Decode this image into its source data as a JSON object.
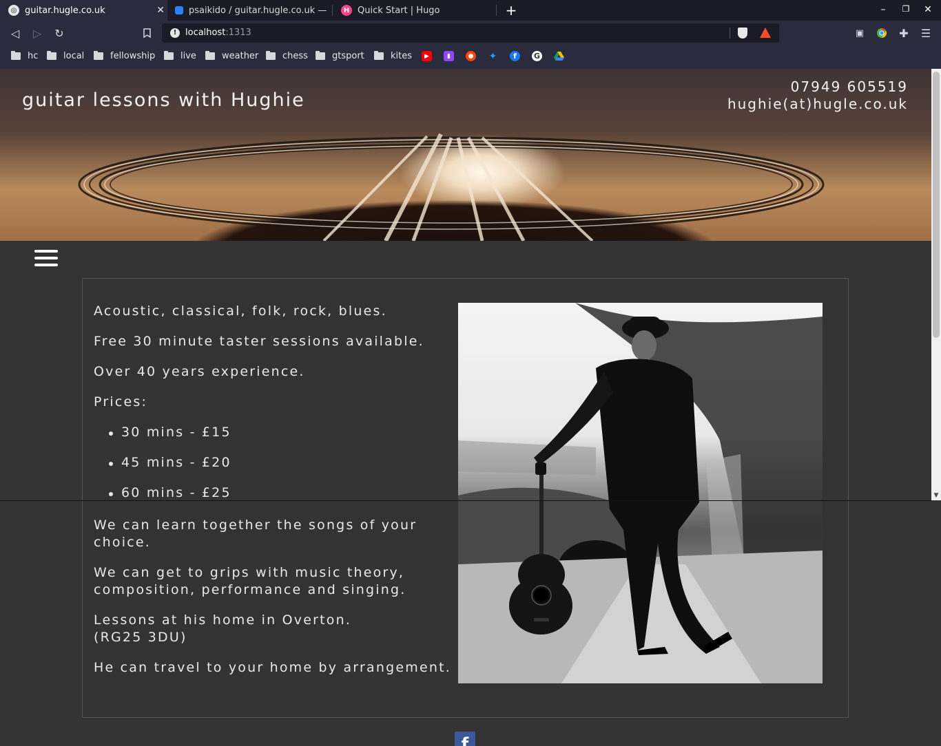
{
  "tabs": [
    {
      "title": "guitar.hugle.co.uk",
      "favicon": "site-icon",
      "active": true
    },
    {
      "title": "psaikido / guitar.hugle.co.uk — Bit",
      "favicon": "bitbucket-icon",
      "active": false
    },
    {
      "title": "Quick Start | Hugo",
      "favicon": "hugo-icon",
      "active": false
    }
  ],
  "toolbar": {
    "url_host": "localhost",
    "url_port": ":1313"
  },
  "bookmarks": {
    "folders": [
      "hc",
      "local",
      "fellowship",
      "live",
      "weather",
      "chess",
      "gtsport",
      "kites"
    ],
    "icons": [
      "youtube-icon",
      "twitch-icon",
      "reddit-icon",
      "twitter-icon",
      "facebook-icon",
      "g-icon",
      "google-drive-icon"
    ]
  },
  "header": {
    "title": "guitar lessons with Hughie",
    "phone": "07949 605519",
    "email": "hughie(at)hugle.co.uk"
  },
  "content": {
    "intro": [
      "Acoustic, classical, folk, rock, blues.",
      "Free 30 minute taster sessions available.",
      "Over 40 years experience.",
      "Prices:"
    ],
    "prices": [
      "30 mins - £15",
      "45 mins - £20",
      "60 mins - £25"
    ],
    "songs": "We can learn together the songs of your choice.",
    "theory": "We can get to grips with music theory, composition, performance and singing.",
    "location_line1": "Lessons at his home in Overton.",
    "location_line2": "(RG25 3DU)",
    "travel": "He can travel to your home by arrangement."
  },
  "footer": {
    "social_icon": "facebook-icon",
    "social_glyph": "f"
  },
  "colors": {
    "page_bg": "#333333",
    "text": "#e8e8e8",
    "chrome_bg": "#2a2c3d",
    "tabbar_bg": "#1a1b26"
  }
}
